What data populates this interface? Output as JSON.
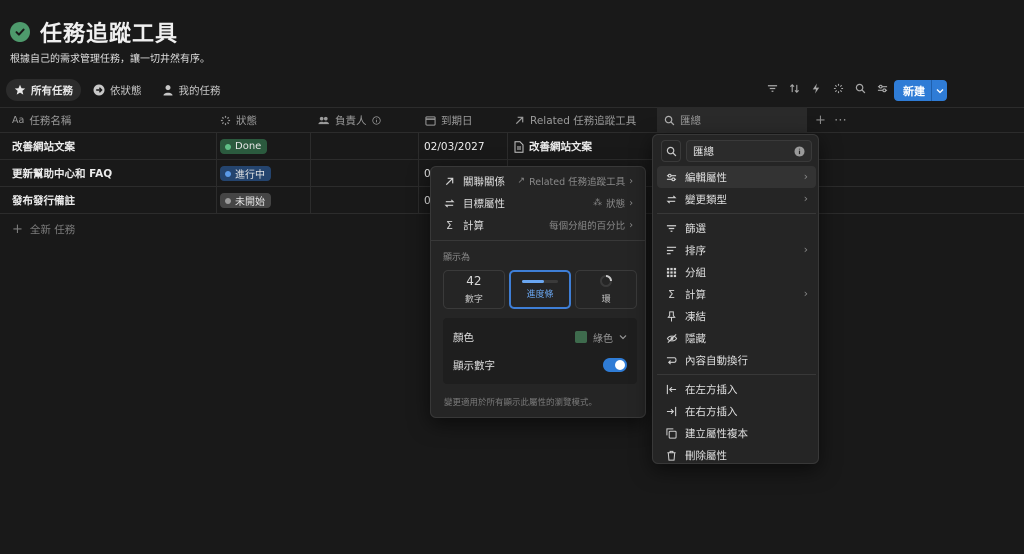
{
  "page": {
    "title": "任務追蹤工具",
    "subtitle": "根據自己的需求管理任務，讓一切井然有序。"
  },
  "tabs": [
    {
      "label": "所有任務",
      "icon": "star-icon",
      "active": true
    },
    {
      "label": "依狀態",
      "icon": "arrow-circle-icon",
      "active": false
    },
    {
      "label": "我的任務",
      "icon": "person-icon",
      "active": false
    }
  ],
  "toolbar": {
    "icons": [
      "filter-icon",
      "sort-icon",
      "lightning-icon",
      "magic-icon",
      "search-icon",
      "settings-icon"
    ],
    "new_label": "新建"
  },
  "table": {
    "columns": {
      "name": "任務名稱",
      "status": "狀態",
      "assignee": "負責人",
      "due": "到期日",
      "related": "Related 任務追蹤工具",
      "rollup": "匯總"
    },
    "name_icon_text": "Aa",
    "rows": [
      {
        "name": "改善網站文案",
        "status": "Done",
        "due": "02/03/2027",
        "related": "改善網站文案"
      },
      {
        "name": "更新幫助中心和 FAQ",
        "status": "進行中",
        "due": "0"
      },
      {
        "name": "發布發行備註",
        "status": "未開始",
        "due": "0"
      }
    ],
    "new_row": "全新 任務"
  },
  "rollup_panel": {
    "relation_label": "關聯關係",
    "relation_value": "Related 任務追蹤工具",
    "property_label": "目標屬性",
    "property_value": "狀態",
    "calc_label": "計算",
    "calc_value": "每個分組的百分比",
    "display_as": "顯示為",
    "options": [
      {
        "big": "42",
        "label": "數字"
      },
      {
        "label": "進度條",
        "selected": true
      },
      {
        "label": "環"
      }
    ],
    "color_label": "顏色",
    "color_value": "綠色",
    "color_swatch": "#3e6b4d",
    "show_number_label": "顯示數字",
    "show_number": true,
    "footnote": "變更適用於所有顯示此屬性的瀏覽模式。"
  },
  "prop_menu": {
    "search_value": "匯總",
    "items": [
      {
        "label": "編輯屬性",
        "icon": "sliders-icon",
        "submenu": true,
        "highlight": true
      },
      {
        "label": "變更類型",
        "icon": "swap-icon",
        "submenu": true
      },
      {
        "label": "篩選",
        "icon": "filter-icon"
      },
      {
        "label": "排序",
        "icon": "sort-icon",
        "submenu": true
      },
      {
        "label": "分組",
        "icon": "grid-icon"
      },
      {
        "label": "計算",
        "icon": "sigma-icon",
        "submenu": true
      },
      {
        "label": "凍結",
        "icon": "pin-icon"
      },
      {
        "label": "隱藏",
        "icon": "eye-off-icon"
      },
      {
        "label": "內容自動換行",
        "icon": "wrap-icon"
      },
      {
        "label": "在左方插入",
        "icon": "insert-left-icon"
      },
      {
        "label": "在右方插入",
        "icon": "insert-right-icon"
      },
      {
        "label": "建立屬性複本",
        "icon": "duplicate-icon"
      },
      {
        "label": "刪除屬性",
        "icon": "trash-icon"
      }
    ]
  }
}
